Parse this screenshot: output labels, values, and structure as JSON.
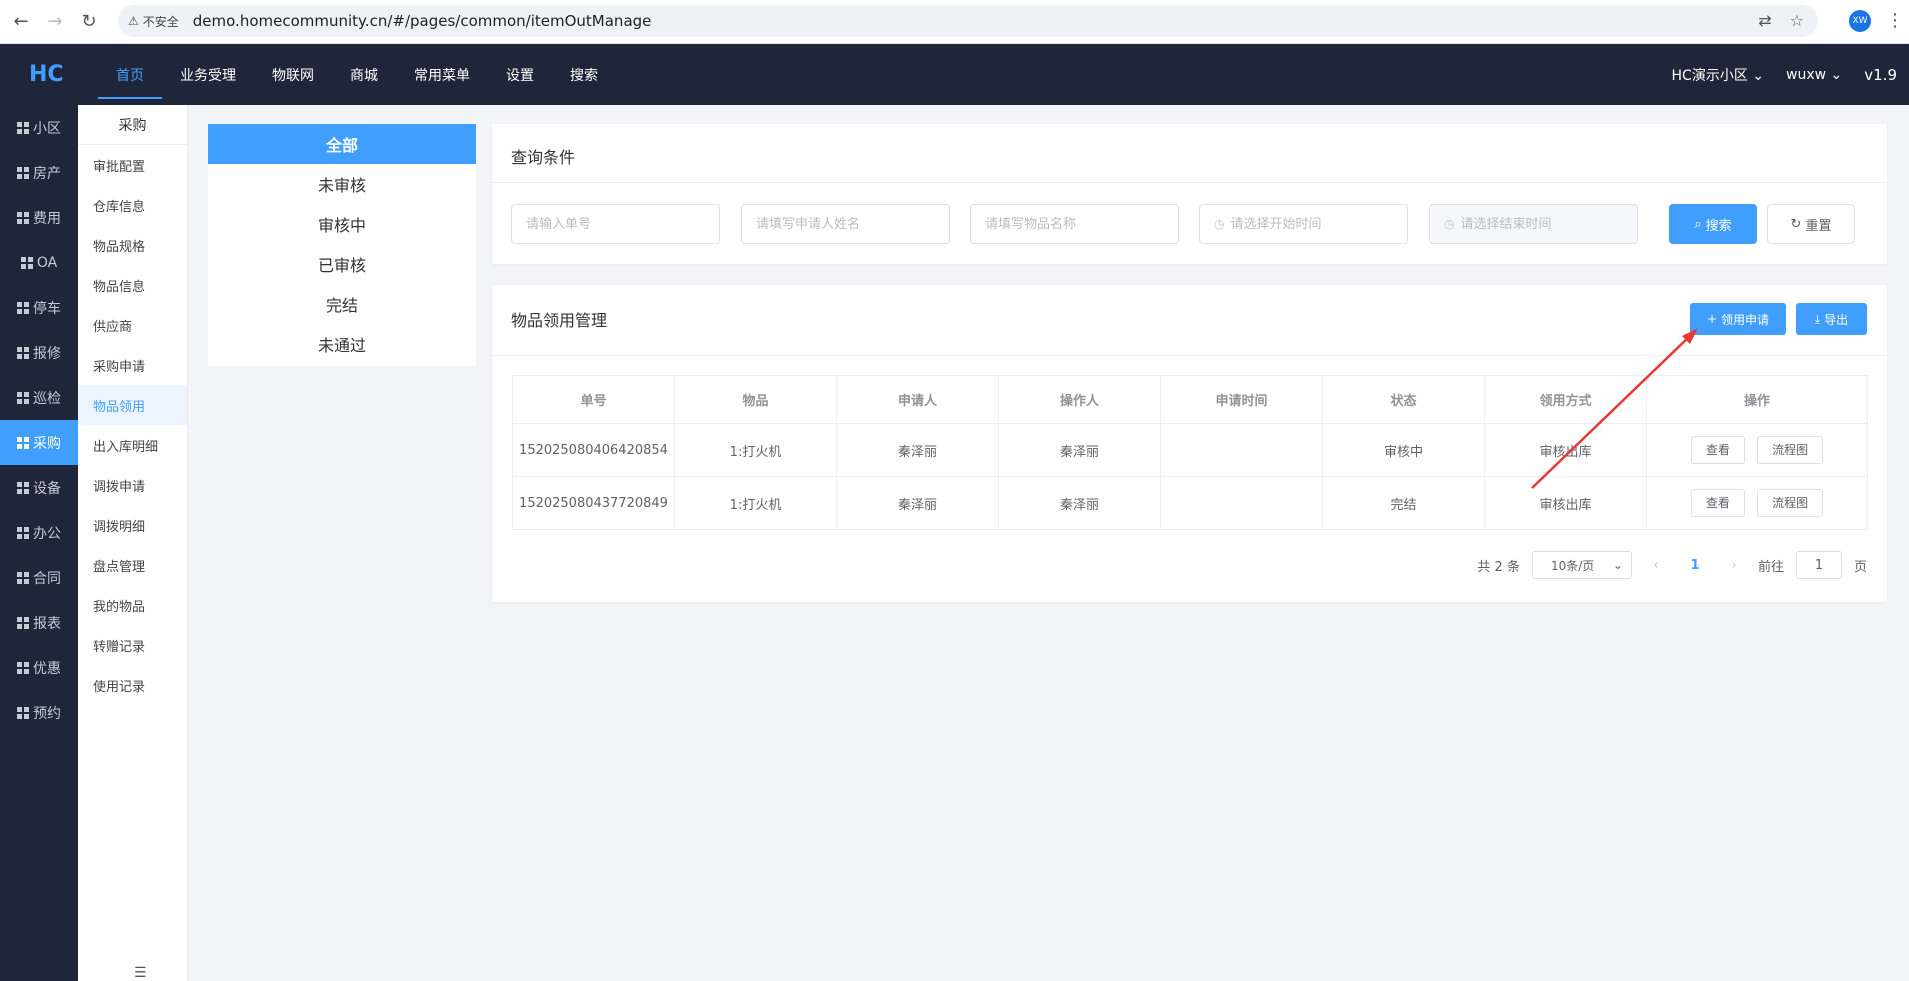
{
  "browser": {
    "not_secure": "不安全",
    "url": "demo.homecommunity.cn/#/pages/common/itemOutManage",
    "profile": "XW"
  },
  "header": {
    "logo": "HC",
    "nav": [
      "首页",
      "业务受理",
      "物联网",
      "商城",
      "常用菜单",
      "设置",
      "搜索"
    ],
    "community": "HC演示小区",
    "user": "wuxw",
    "version": "v1.9"
  },
  "sidebar": {
    "items": [
      "小区",
      "房产",
      "费用",
      "OA",
      "停车",
      "报修",
      "巡检",
      "采购",
      "设备",
      "办公",
      "合同",
      "报表",
      "优惠",
      "预约"
    ]
  },
  "submenu": {
    "title": "采购",
    "items": [
      "审批配置",
      "仓库信息",
      "物品规格",
      "物品信息",
      "供应商",
      "采购申请",
      "物品领用",
      "出入库明细",
      "调拨申请",
      "调拨明细",
      "盘点管理",
      "我的物品",
      "转赠记录",
      "使用记录"
    ]
  },
  "status_filter": [
    "全部",
    "未审核",
    "审核中",
    "已审核",
    "完结",
    "未通过"
  ],
  "query": {
    "title": "查询条件",
    "order_no_placeholder": "请输入单号",
    "applicant_placeholder": "请填写申请人姓名",
    "item_placeholder": "请填写物品名称",
    "start_placeholder": "请选择开始时间",
    "end_placeholder": "请选择结束时间",
    "search_label": "搜索",
    "reset_label": "重置"
  },
  "main": {
    "title": "物品领用管理",
    "apply_label": "领用申请",
    "export_label": "导出",
    "columns": [
      "单号",
      "物品",
      "申请人",
      "操作人",
      "申请时间",
      "状态",
      "领用方式",
      "操作"
    ],
    "rows": [
      {
        "no": "152025080406420854",
        "item": "1:打火机",
        "applicant": "秦泽丽",
        "operator": "秦泽丽",
        "time": "",
        "status": "审核中",
        "method": "审核出库",
        "view": "查看",
        "flow": "流程图"
      },
      {
        "no": "152025080437720849",
        "item": "1:打火机",
        "applicant": "秦泽丽",
        "operator": "秦泽丽",
        "time": "",
        "status": "完结",
        "method": "审核出库",
        "view": "查看",
        "flow": "流程图"
      }
    ]
  },
  "pagination": {
    "total": "共 2 条",
    "page_size": "10条/页",
    "current": "1",
    "goto_prefix": "前往",
    "goto_value": "1",
    "goto_suffix": "页"
  },
  "colors": {
    "accent": "#409eff",
    "dark": "#202639",
    "annotation": "#e53935"
  }
}
